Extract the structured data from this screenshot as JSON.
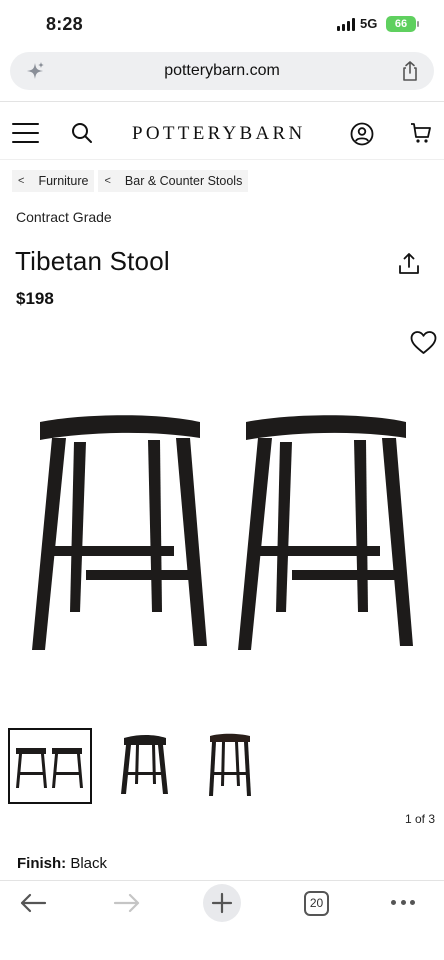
{
  "status_bar": {
    "time": "8:28",
    "network": "5G",
    "battery": "66"
  },
  "browser": {
    "url": "potterybarn.com",
    "tab_count": "20"
  },
  "site": {
    "logo": "POTTERYBARN"
  },
  "breadcrumbs": [
    {
      "label": "Furniture"
    },
    {
      "label": "Bar & Counter Stools"
    }
  ],
  "product": {
    "grade": "Contract Grade",
    "title": "Tibetan Stool",
    "price": "$198",
    "pager": "1 of 3",
    "finish_label": "Finish:",
    "finish_value": "Black"
  },
  "colors": {
    "accent": "#111111",
    "stool": "#1d1b1a",
    "battery": "#5fd05f"
  },
  "icons": [
    "sparkle-icon",
    "share-icon",
    "menu-icon",
    "search-icon",
    "account-icon",
    "cart-icon",
    "heart-icon",
    "back-icon",
    "forward-icon",
    "plus-icon",
    "tabs-icon",
    "more-icon"
  ]
}
